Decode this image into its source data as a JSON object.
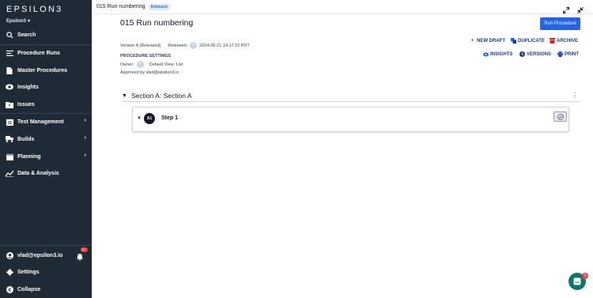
{
  "brand": {
    "logo": "EPSILON3",
    "workspace": "Epsilon3"
  },
  "sidebar": {
    "items": [
      {
        "label": "Search",
        "icon": "search-icon"
      },
      {
        "label": "Procedure Runs",
        "icon": "runs-list-icon"
      },
      {
        "label": "Master Procedures",
        "icon": "document-icon"
      },
      {
        "label": "Insights",
        "icon": "eye-icon"
      },
      {
        "label": "Issues",
        "icon": "issues-folder-icon"
      },
      {
        "label": "Test Management",
        "icon": "clipboard-icon",
        "expandable": true
      },
      {
        "label": "Builds",
        "icon": "truck-icon",
        "expandable": true
      },
      {
        "label": "Planning",
        "icon": "calendar-icon",
        "expandable": true
      },
      {
        "label": "Data & Analysis",
        "icon": "chart-line-icon"
      }
    ],
    "footer": {
      "user": "vlad@epsilon3.io",
      "notifications_badge": "9+",
      "settings": "Settings",
      "collapse": "Collapse"
    }
  },
  "topbar": {
    "title": "015 Run numbering",
    "status": "Released"
  },
  "procedure": {
    "title": "015 Run numbering",
    "run_button": "Run Procedure",
    "version": "Version A (Released)",
    "released_label": "Released:",
    "released_avatar": "V",
    "released_at": "2024-06-21 14:17:22 PDT",
    "settings_heading": "PROCEDURE SETTINGS",
    "owner_label": "Owner:",
    "owner_avatar": "V",
    "default_view": "Default View: List",
    "approved_by": "Approved by vlad@epsilon3.io",
    "actions_row1": [
      "NEW DRAFT",
      "DUPLICATE",
      "ARCHIVE"
    ],
    "actions_row2": [
      "INSIGHTS",
      "VERSIONS",
      "PRINT"
    ]
  },
  "section": {
    "title": "Section A: Section A"
  },
  "step": {
    "badge": "A1",
    "label": "Step 1"
  },
  "chat": {
    "badge": "1"
  },
  "colors": {
    "sidebar": "#1f2a37",
    "accent": "#2563eb",
    "archive": "#dc2626"
  }
}
